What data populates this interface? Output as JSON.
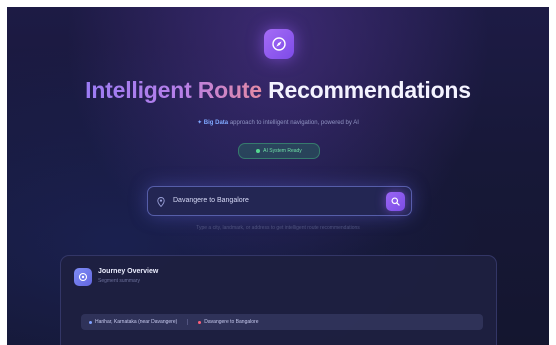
{
  "header": {
    "logo_icon": "compass-icon",
    "title_highlight": "Intelligent Route",
    "title_rest": "Recommendations",
    "subtitle_highlight": "Big Data",
    "subtitle_rest": "approach to intelligent navigation, powered by AI",
    "status_label": "AI System Ready"
  },
  "search": {
    "pin_icon": "location-pin-icon",
    "value": "Davangere to Bangalore",
    "button_icon": "search-icon",
    "hint": "Type a city, landmark, or address to get intelligent route recommendations"
  },
  "overview": {
    "icon": "route-icon",
    "title": "Journey Overview",
    "subtitle": "Segment summary",
    "route_items": [
      {
        "label": "Harihar, Karnataka (near Davangere)"
      },
      {
        "label": "Davangere to Bangalore"
      }
    ]
  },
  "colors": {
    "accent_purple": "#8b5cf6",
    "status_green": "#54d990",
    "background": "#171838"
  }
}
